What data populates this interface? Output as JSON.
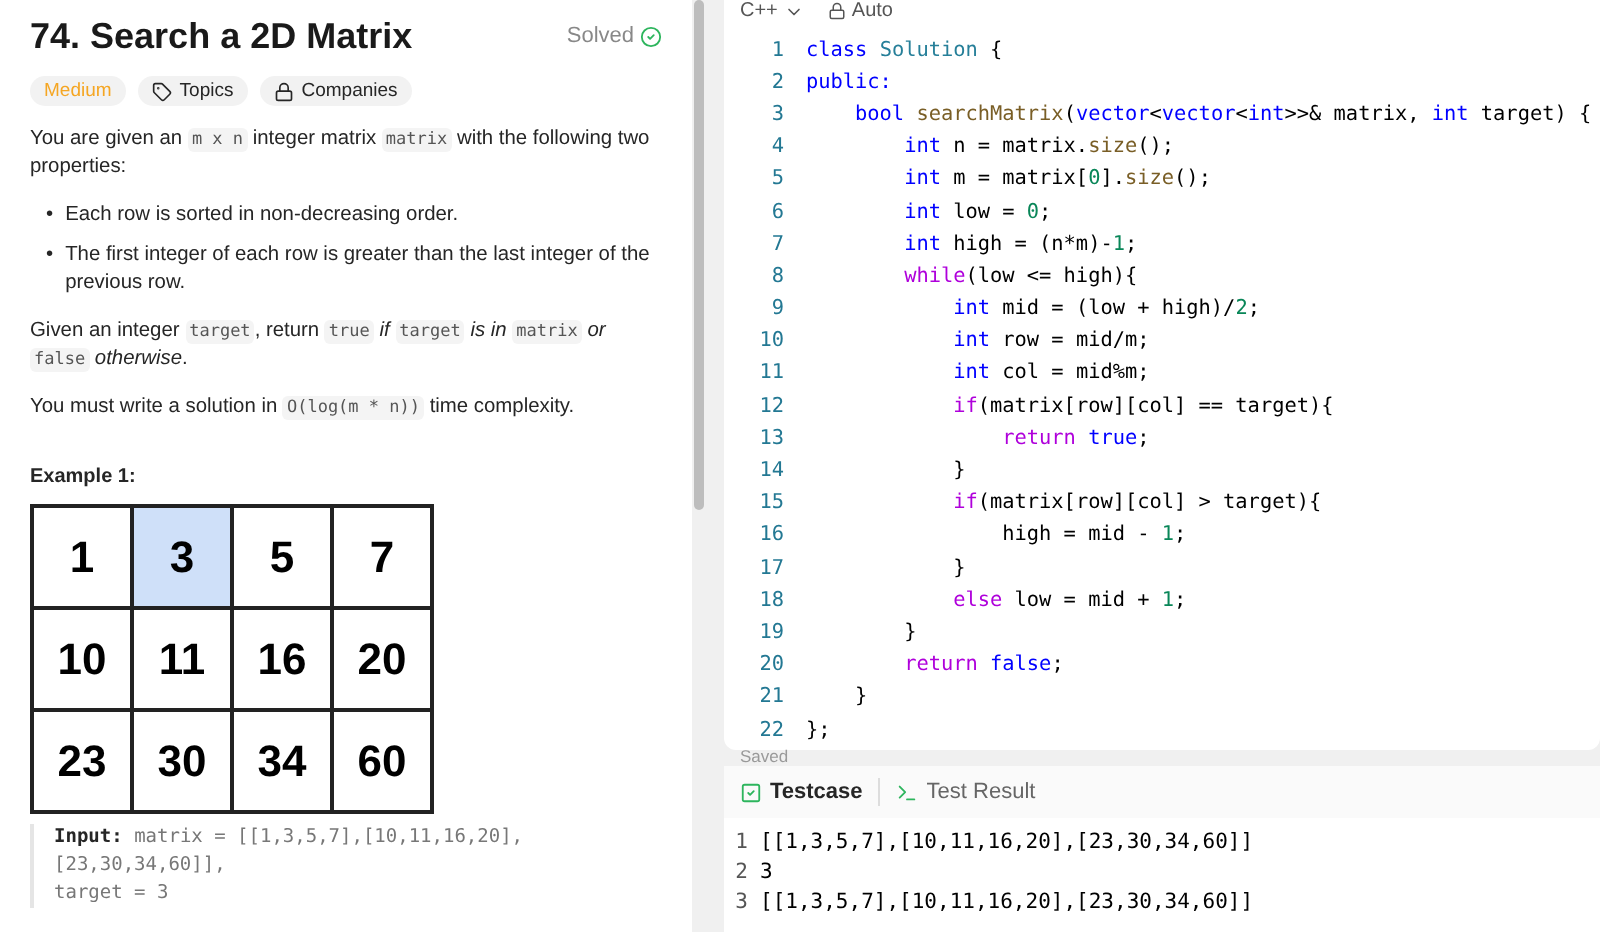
{
  "problem": {
    "title": "74. Search a 2D Matrix",
    "status": "Solved",
    "solved": true,
    "tags": [
      {
        "kind": "difficulty",
        "label": "Medium"
      },
      {
        "kind": "topics",
        "label": "Topics"
      },
      {
        "kind": "companies",
        "label": "Companies"
      }
    ],
    "paragraphs": [
      [
        {
          "kind": "text",
          "text": "You are given an "
        },
        {
          "kind": "code",
          "text": "m x n"
        },
        {
          "kind": "text",
          "text": " integer matrix "
        },
        {
          "kind": "code",
          "text": "matrix"
        },
        {
          "kind": "text",
          "text": " with the following two properties:"
        }
      ],
      [
        {
          "kind": "text",
          "text": "Given an integer "
        },
        {
          "kind": "code",
          "text": "target"
        },
        {
          "kind": "text",
          "text": ", return "
        },
        {
          "kind": "code",
          "text": "true"
        },
        {
          "kind": "italic",
          "text": " if "
        },
        {
          "kind": "code",
          "text": "target"
        },
        {
          "kind": "italic",
          "text": " is in "
        },
        {
          "kind": "code",
          "text": "matrix"
        },
        {
          "kind": "italic",
          "text": " or "
        },
        {
          "kind": "code",
          "text": "false"
        },
        {
          "kind": "italic",
          "text": " otherwise"
        },
        {
          "kind": "text",
          "text": "."
        }
      ],
      [
        {
          "kind": "text",
          "text": "You must write a solution in "
        },
        {
          "kind": "code",
          "text": "O(log(m * n))"
        },
        {
          "kind": "text",
          "text": " time complexity."
        }
      ]
    ],
    "bullets": [
      {
        "marker": "•",
        "text": "Each row is sorted in non-decreasing order."
      },
      {
        "marker": "•",
        "text": "The first integer of each row is greater than the last integer of the previous row."
      }
    ],
    "example": {
      "heading": "Example 1:",
      "matrix": [
        [
          {
            "value": "1",
            "selected": false
          },
          {
            "value": "3",
            "selected": true
          },
          {
            "value": "5",
            "selected": false
          },
          {
            "value": "7",
            "selected": false
          }
        ],
        [
          {
            "value": "10",
            "selected": false
          },
          {
            "value": "11",
            "selected": false
          },
          {
            "value": "16",
            "selected": false
          },
          {
            "value": "20",
            "selected": false
          }
        ],
        [
          {
            "value": "23",
            "selected": false
          },
          {
            "value": "30",
            "selected": false
          },
          {
            "value": "34",
            "selected": false
          },
          {
            "value": "60",
            "selected": false
          }
        ]
      ],
      "input_label": "Input:",
      "input_lines": [
        "matrix = [[1,3,5,7],[10,11,16,20],[23,30,34,60]],",
        "target = 3"
      ]
    }
  },
  "editor": {
    "language": "C++",
    "mode": "Auto",
    "status": "Saved",
    "lines": [
      {
        "number": "1",
        "tokens": [
          {
            "kind": "kw",
            "text": "class "
          },
          {
            "kind": "cls",
            "text": "Solution"
          },
          {
            "kind": "plain",
            "text": " {"
          }
        ]
      },
      {
        "number": "2",
        "tokens": [
          {
            "kind": "kw",
            "text": "public:"
          }
        ]
      },
      {
        "number": "3",
        "tokens": [
          {
            "kind": "kw",
            "text": "    bool "
          },
          {
            "kind": "fn",
            "text": "searchMatrix"
          },
          {
            "kind": "plain",
            "text": "("
          },
          {
            "kind": "kw",
            "text": "vector"
          },
          {
            "kind": "plain",
            "text": "<"
          },
          {
            "kind": "kw",
            "text": "vector"
          },
          {
            "kind": "plain",
            "text": "<"
          },
          {
            "kind": "kw",
            "text": "int"
          },
          {
            "kind": "plain",
            "text": ">>& matrix, "
          },
          {
            "kind": "kw",
            "text": "int"
          },
          {
            "kind": "plain",
            "text": " target) {"
          }
        ]
      },
      {
        "number": "4",
        "tokens": [
          {
            "kind": "kw",
            "text": "        int"
          },
          {
            "kind": "plain",
            "text": " n = matrix."
          },
          {
            "kind": "fn",
            "text": "size"
          },
          {
            "kind": "plain",
            "text": "();"
          }
        ]
      },
      {
        "number": "5",
        "tokens": [
          {
            "kind": "kw",
            "text": "        int"
          },
          {
            "kind": "plain",
            "text": " m = matrix["
          },
          {
            "kind": "num",
            "text": "0"
          },
          {
            "kind": "plain",
            "text": "]."
          },
          {
            "kind": "fn",
            "text": "size"
          },
          {
            "kind": "plain",
            "text": "();"
          }
        ]
      },
      {
        "number": "6",
        "tokens": [
          {
            "kind": "kw",
            "text": "        int"
          },
          {
            "kind": "plain",
            "text": " low = "
          },
          {
            "kind": "num",
            "text": "0"
          },
          {
            "kind": "plain",
            "text": ";"
          }
        ]
      },
      {
        "number": "7",
        "tokens": [
          {
            "kind": "kw",
            "text": "        int"
          },
          {
            "kind": "plain",
            "text": " high = (n*m)-"
          },
          {
            "kind": "num",
            "text": "1"
          },
          {
            "kind": "plain",
            "text": ";"
          }
        ]
      },
      {
        "number": "8",
        "tokens": [
          {
            "kind": "ctl",
            "text": "        while"
          },
          {
            "kind": "plain",
            "text": "(low <= high){"
          }
        ]
      },
      {
        "number": "9",
        "tokens": [
          {
            "kind": "kw",
            "text": "            int"
          },
          {
            "kind": "plain",
            "text": " mid = (low + high)/"
          },
          {
            "kind": "num",
            "text": "2"
          },
          {
            "kind": "plain",
            "text": ";"
          }
        ]
      },
      {
        "number": "10",
        "tokens": [
          {
            "kind": "kw",
            "text": "            int"
          },
          {
            "kind": "plain",
            "text": " row = mid/m;"
          }
        ]
      },
      {
        "number": "11",
        "tokens": [
          {
            "kind": "kw",
            "text": "            int"
          },
          {
            "kind": "plain",
            "text": " col = mid%m;"
          }
        ]
      },
      {
        "number": "12",
        "tokens": [
          {
            "kind": "ctl",
            "text": "            if"
          },
          {
            "kind": "plain",
            "text": "(matrix[row][col] == target){"
          }
        ]
      },
      {
        "number": "13",
        "tokens": [
          {
            "kind": "ctl",
            "text": "                return "
          },
          {
            "kind": "kw",
            "text": "true"
          },
          {
            "kind": "plain",
            "text": ";"
          }
        ]
      },
      {
        "number": "14",
        "tokens": [
          {
            "kind": "plain",
            "text": "            }"
          }
        ]
      },
      {
        "number": "15",
        "tokens": [
          {
            "kind": "ctl",
            "text": "            if"
          },
          {
            "kind": "plain",
            "text": "(matrix[row][col] > target){"
          }
        ]
      },
      {
        "number": "16",
        "tokens": [
          {
            "kind": "plain",
            "text": "                high = mid - "
          },
          {
            "kind": "num",
            "text": "1"
          },
          {
            "kind": "plain",
            "text": ";"
          }
        ]
      },
      {
        "number": "17",
        "tokens": [
          {
            "kind": "plain",
            "text": "            }"
          }
        ]
      },
      {
        "number": "18",
        "tokens": [
          {
            "kind": "ctl",
            "text": "            else"
          },
          {
            "kind": "plain",
            "text": " low = mid + "
          },
          {
            "kind": "num",
            "text": "1"
          },
          {
            "kind": "plain",
            "text": ";"
          }
        ]
      },
      {
        "number": "19",
        "tokens": [
          {
            "kind": "plain",
            "text": "        }"
          }
        ]
      },
      {
        "number": "20",
        "tokens": [
          {
            "kind": "ctl",
            "text": "        return "
          },
          {
            "kind": "kw",
            "text": "false"
          },
          {
            "kind": "plain",
            "text": ";"
          }
        ]
      },
      {
        "number": "21",
        "tokens": [
          {
            "kind": "plain",
            "text": "    }"
          }
        ]
      },
      {
        "number": "22",
        "tokens": [
          {
            "kind": "plain",
            "text": "};"
          }
        ]
      }
    ]
  },
  "console": {
    "tabs": [
      {
        "kind": "testcase",
        "label": "Testcase",
        "selected": true
      },
      {
        "kind": "result",
        "label": "Test Result",
        "selected": false
      }
    ],
    "lines": [
      {
        "number": "1",
        "text": "[[1,3,5,7],[10,11,16,20],[23,30,34,60]]"
      },
      {
        "number": "2",
        "text": "3"
      },
      {
        "number": "3",
        "text": "[[1,3,5,7],[10,11,16,20],[23,30,34,60]]"
      }
    ]
  }
}
